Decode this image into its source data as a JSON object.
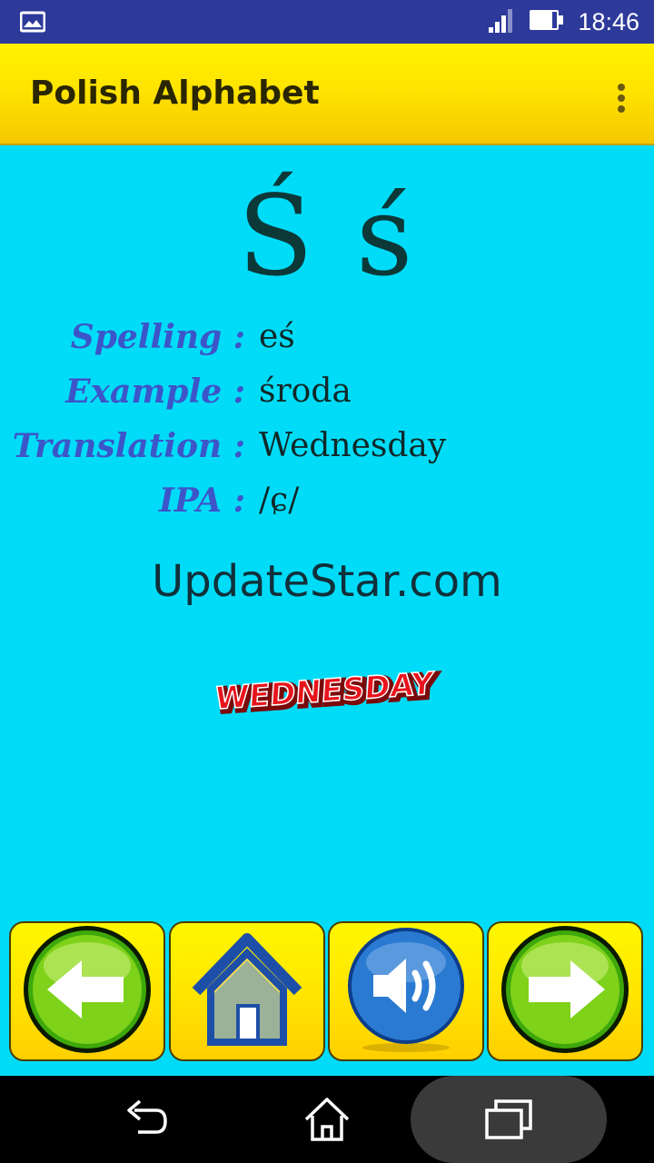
{
  "status_bar": {
    "time": "18:46",
    "icons": [
      "gallery-notification-icon",
      "signal-icon",
      "battery-icon"
    ]
  },
  "app_bar": {
    "title": "Polish Alphabet",
    "menu_icon": "overflow-menu-icon"
  },
  "letter": {
    "display": "Ś ś"
  },
  "details": [
    {
      "label": "Spelling :",
      "value": "eś"
    },
    {
      "label": "Example :",
      "value": "środa"
    },
    {
      "label": "Translation :",
      "value": "Wednesday"
    },
    {
      "label": "IPA :",
      "value": "/ɕ/"
    }
  ],
  "watermark": "UpdateStar.com",
  "word_art": "WEDNESDAY",
  "buttons": [
    {
      "name": "previous-button",
      "icon": "arrow-left-icon"
    },
    {
      "name": "home-button",
      "icon": "home-icon"
    },
    {
      "name": "speaker-button",
      "icon": "speaker-icon"
    },
    {
      "name": "next-button",
      "icon": "arrow-right-icon"
    }
  ],
  "colors": {
    "background": "#00dcf8",
    "status_bar": "#2e3a9a",
    "app_bar": "#ffe400",
    "label": "#3c55c8",
    "word_art": "#e8141c"
  },
  "system_nav": [
    "back-icon",
    "home-icon",
    "recents-icon"
  ]
}
